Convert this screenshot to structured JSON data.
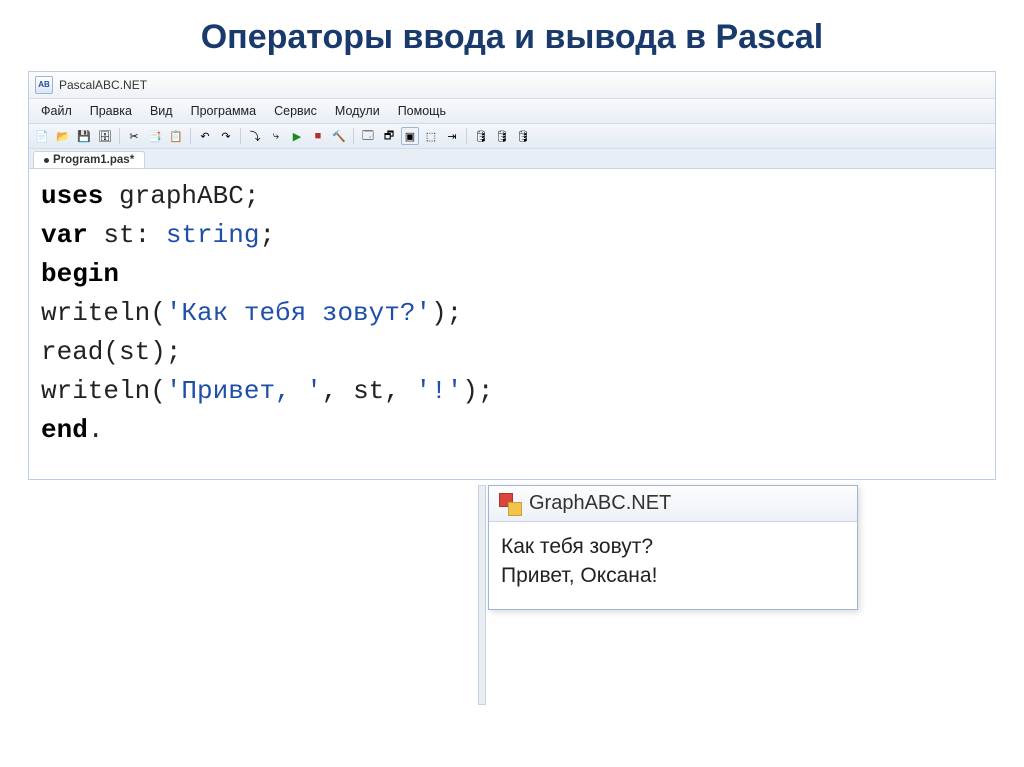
{
  "slide": {
    "title": "Операторы ввода и вывода в Pascal"
  },
  "app": {
    "title": "PascalABC.NET",
    "iconText": "AB"
  },
  "menu": {
    "file": "Файл",
    "edit": "Правка",
    "view": "Вид",
    "program": "Программа",
    "service": "Сервис",
    "modules": "Модули",
    "help": "Помощь"
  },
  "tab": {
    "label": "Program1.pas*"
  },
  "code": {
    "l1_uses": "uses",
    "l1_mod": " graphABC",
    "l1_semi": ";",
    "l2_var": "var",
    "l2_id": " st: ",
    "l2_type": "string",
    "l2_semi": ";",
    "l3_begin": "begin",
    "l4_fn": "writeln(",
    "l4_str": "'Как тебя зовут?'",
    "l4_end": ");",
    "l5": "read(st);",
    "l6_fn": "writeln(",
    "l6_s1": "'Привет, '",
    "l6_mid": ", st, ",
    "l6_s2": "'!'",
    "l6_end": ");",
    "l7_end": "end",
    "l7_dot": "."
  },
  "output": {
    "title": "GraphABC.NET",
    "line1": "Как тебя зовут?",
    "line2": "Привет, Оксана!"
  },
  "icons": {
    "new": "📄",
    "open": "📂",
    "save": "💾",
    "saveall": "🗄",
    "cut": "✂",
    "copy": "📑",
    "paste": "📋",
    "undo": "↶",
    "redo": "↷",
    "stepover": "⤵",
    "stepin": "⤷",
    "run": "▶",
    "stop": "■",
    "compile": "🔨",
    "win1": "🗔",
    "win2": "🗗",
    "box": "▣",
    "panel": "⬚",
    "toend": "⇥",
    "db1": "🛢",
    "db2": "🛢",
    "db3": "🛢"
  }
}
